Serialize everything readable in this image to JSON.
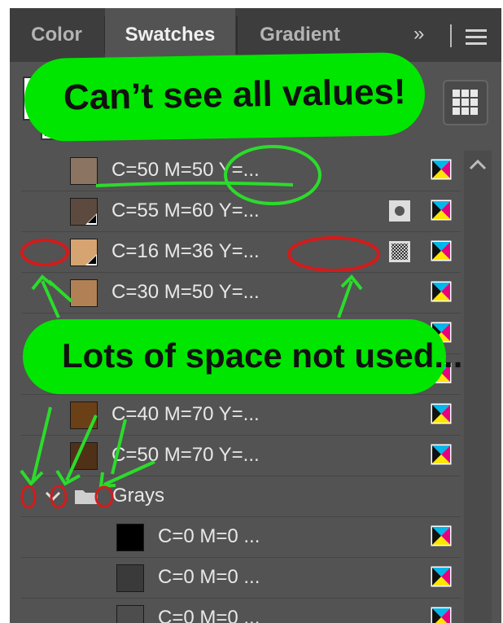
{
  "tabs": [
    {
      "label": "Color",
      "active": false
    },
    {
      "label": "Swatches",
      "active": true
    },
    {
      "label": "Gradient",
      "active": false
    }
  ],
  "more_glyph": "»",
  "callouts": {
    "top": "Can’t see all values!",
    "middle": "Lots of space not used..."
  },
  "swatches": [
    {
      "label": "C=50 M=50 Y=...",
      "color": "#8b7461",
      "global": false,
      "spot": null
    },
    {
      "label": "C=55 M=60 Y=...",
      "color": "#5d4a3e",
      "global": true,
      "spot": "spot-circle-icon"
    },
    {
      "label": "C=16 M=36 Y=...",
      "color": "#d6a471",
      "global": true,
      "spot": "spot-pattern-icon"
    },
    {
      "label": "C=30 M=50 Y=...",
      "color": "#b18155",
      "global": false,
      "spot": null
    },
    {
      "label": "",
      "color": "#986a43",
      "global": false,
      "spot": null
    },
    {
      "label": "",
      "color": "#7a4f2c",
      "global": false,
      "spot": null
    },
    {
      "label": "C=40 M=70 Y=...",
      "color": "#6b4017",
      "global": false,
      "spot": null
    },
    {
      "label": "C=50 M=70 Y=...",
      "color": "#4f3118",
      "global": false,
      "spot": null
    }
  ],
  "group": {
    "label": "Grays"
  },
  "grays": [
    {
      "label": "C=0 M=0 ...",
      "color": "#000000"
    },
    {
      "label": "C=0 M=0 ...",
      "color": "#3a3a3a"
    },
    {
      "label": "C=0 M=0 ...",
      "color": "#4d4d4d"
    }
  ],
  "colors": {
    "panel": "#535353",
    "tab_bar": "#3d3d3d",
    "callout_green": "#00e600",
    "annotation_red": "#d31b1b",
    "annotation_green": "#2bdc2b"
  },
  "icons": {
    "mode": "cmyk-process-icon",
    "grid": "grid-view-icon",
    "menu": "panel-menu-icon",
    "folder": "folder-icon"
  }
}
